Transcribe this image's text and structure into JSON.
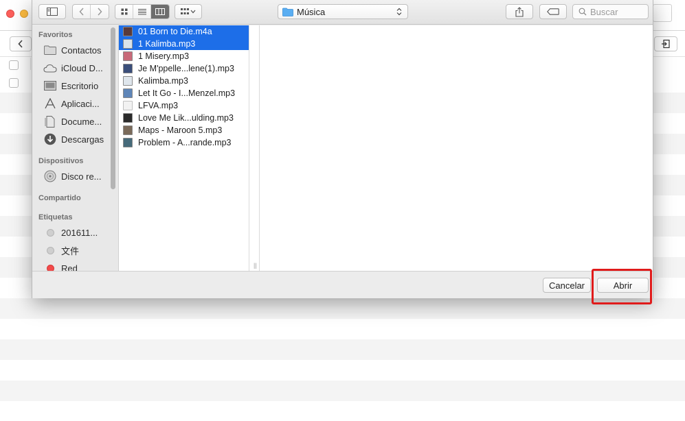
{
  "dialog": {
    "location": "Música",
    "search_placeholder": "Buscar",
    "cancel_label": "Cancelar",
    "open_label": "Abrir"
  },
  "sidebar": {
    "favorites_header": "Favoritos",
    "favorites": [
      {
        "label": "Contactos",
        "icon": "folder-icon"
      },
      {
        "label": "iCloud D...",
        "icon": "cloud-icon"
      },
      {
        "label": "Escritorio",
        "icon": "desktop-icon"
      },
      {
        "label": "Aplicaci...",
        "icon": "applications-icon"
      },
      {
        "label": "Docume...",
        "icon": "documents-icon"
      },
      {
        "label": "Descargas",
        "icon": "downloads-icon"
      }
    ],
    "devices_header": "Dispositivos",
    "devices": [
      {
        "label": "Disco re...",
        "icon": "disc-icon"
      }
    ],
    "shared_header": "Compartido",
    "tags_header": "Etiquetas",
    "tags": [
      {
        "label": "201611...",
        "color": "#cfcfcf"
      },
      {
        "label": "文件",
        "color": "#cfcfcf"
      },
      {
        "label": "Red",
        "color": "#f24a4a"
      }
    ]
  },
  "files": [
    {
      "name": "01 Born to Die.m4a",
      "selected": true,
      "thumb": "#5a3a3a"
    },
    {
      "name": "1 Kalimba.mp3",
      "selected": true,
      "thumb": "#d9e3ea"
    },
    {
      "name": "1 Misery.mp3",
      "selected": false,
      "thumb": "#c86a7a"
    },
    {
      "name": "Je M'ppelle...lene(1).mp3",
      "selected": false,
      "thumb": "#3a4e7a"
    },
    {
      "name": "Kalimba.mp3",
      "selected": false,
      "thumb": "#dfe6ec"
    },
    {
      "name": "Let It Go - I...Menzel.mp3",
      "selected": false,
      "thumb": "#5f86b8"
    },
    {
      "name": "LFVA.mp3",
      "selected": false,
      "thumb": "#f2f2f2"
    },
    {
      "name": "Love Me Lik...ulding.mp3",
      "selected": false,
      "thumb": "#2b2b2b"
    },
    {
      "name": "Maps - Maroon 5.mp3",
      "selected": false,
      "thumb": "#7a6a5a"
    },
    {
      "name": "Problem - A...rande.mp3",
      "selected": false,
      "thumb": "#466a7a"
    }
  ]
}
